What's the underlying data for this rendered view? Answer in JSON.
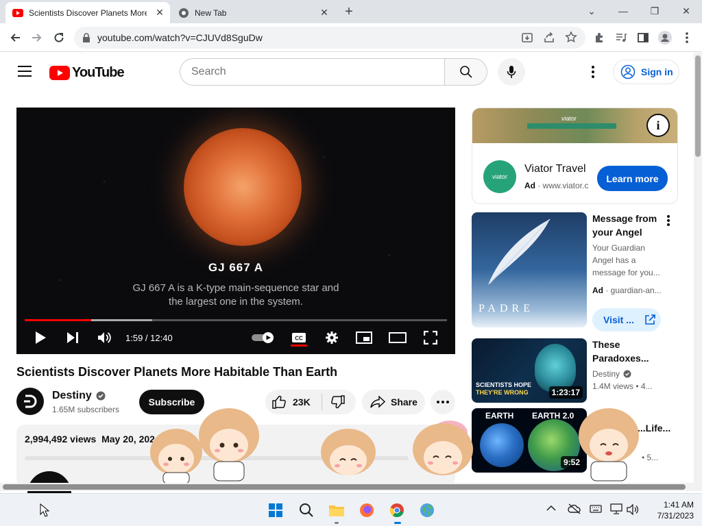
{
  "browser": {
    "tabs": [
      {
        "title": "Scientists Discover Planets More",
        "active": true
      },
      {
        "title": "New Tab",
        "active": false
      }
    ],
    "url": "youtube.com/watch?v=CJUVd8SguDw"
  },
  "youtube": {
    "logo_text": "YouTube",
    "search_placeholder": "Search",
    "signin_label": "Sign in"
  },
  "player": {
    "caption_title": "GJ 667 A",
    "caption_line1": "GJ 667 A is a K-type main-sequence star and",
    "caption_line2": "the largest one in the system.",
    "time": "1:59 / 12:40",
    "played_fraction": 0.157,
    "buffered_fraction": 0.302
  },
  "video": {
    "title": "Scientists Discover Planets More Habitable Than Earth",
    "channel": "Destiny",
    "subscribers": "1.65M subscribers",
    "subscribe_label": "Subscribe",
    "likes": "23K",
    "share_label": "Share",
    "views": "2,994,492 views",
    "date": "May 20, 202"
  },
  "sidebar": {
    "ad": {
      "banner_text": "viator",
      "logo_text": "viator",
      "name": "Viator Travel",
      "badge": "Ad",
      "domain": "· www.viator.c",
      "cta": "Learn more"
    },
    "recommendations": [
      {
        "title": "Message from your Angel",
        "meta1": "Your Guardian Angel has a message for you...",
        "badge": "Ad",
        "meta2": "· guardian-an...",
        "thumb_text": "PADRE",
        "visit_label": "Visit ..."
      },
      {
        "title": "These Paradoxes...",
        "channel": "Destiny",
        "stats": "1.4M views  • 4...",
        "duration": "1:23:17",
        "thumb_text1": "SCIENTISTS HOPE",
        "thumb_text2": "THEY'RE WRONG"
      },
      {
        "title": "...Life...",
        "channel": "",
        "stats": "• 5...",
        "duration": "9:52",
        "thumb_text1": "EARTH",
        "thumb_text2": "EARTH 2.0"
      }
    ]
  },
  "taskbar": {
    "time": "1:41 AM",
    "date": "7/31/2023"
  },
  "colors": {
    "youtube_red": "#ff0000",
    "link_blue": "#065fd4"
  }
}
